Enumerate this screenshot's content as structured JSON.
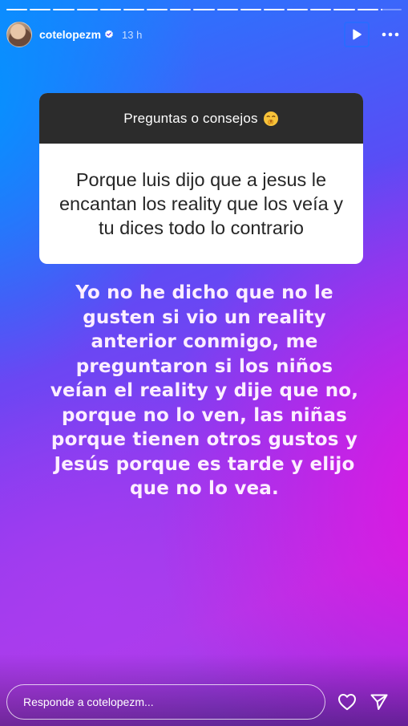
{
  "story": {
    "segments_total": 17,
    "segments_complete": 16,
    "current_segment_progress": 0.1
  },
  "header": {
    "username": "cotelopezm",
    "time_ago": "13 h",
    "verified_icon": "verified-badge-icon",
    "play_icon": "play-icon",
    "more_icon": "more-options-icon"
  },
  "question_card": {
    "header_label": "Preguntas o consejos",
    "emoji_icon": "shushing-face-emoji",
    "question": "Porque luis dijo que a jesus le encantan los reality que los veía y tu dices todo lo contrario"
  },
  "answer": {
    "text": "Yo no he dicho que no le gusten si vio un reality anterior conmigo, me preguntaron si los niños veían el reality y dije que no, porque no lo ven, las niñas porque tienen otros gustos y Jesús porque es tarde y elijo que no lo vea."
  },
  "footer": {
    "reply_placeholder": "Responde a cotelopezm...",
    "like_icon": "heart-icon",
    "send_icon": "send-icon"
  },
  "colors": {
    "gradient_blue": "#1f7dff",
    "gradient_purple": "#8a3cf0",
    "gradient_magenta": "#e114e1",
    "card_header": "#2c2c2c",
    "card_body": "#ffffff",
    "play_button_border": "#2a6bff"
  }
}
